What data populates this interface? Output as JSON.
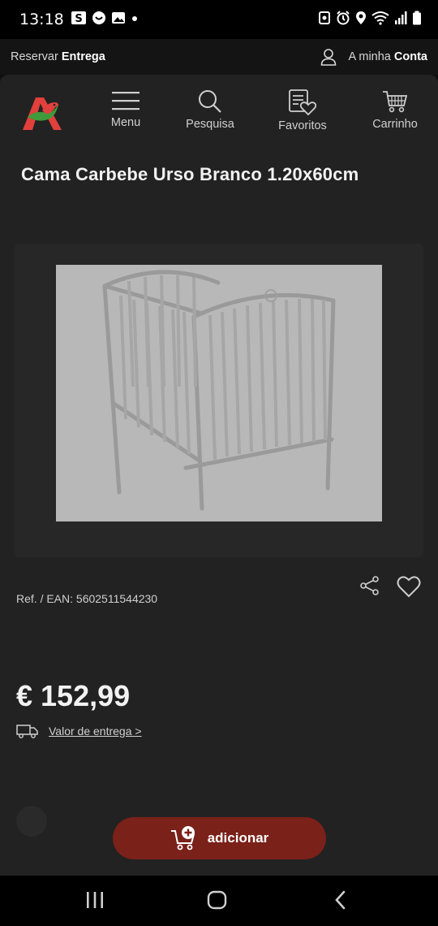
{
  "status_bar": {
    "time": "13:18",
    "icons_left": [
      "s-icon",
      "notification-icon",
      "gallery-icon",
      "dot-icon"
    ],
    "icons_right": [
      "nfc-icon",
      "alarm-icon",
      "location-icon",
      "wifi-icon",
      "signal-icon",
      "battery-icon"
    ]
  },
  "top_strip": {
    "reserve_prefix": "Reservar",
    "reserve_bold": "Entrega",
    "account_prefix": "A minha",
    "account_bold": "Conta"
  },
  "nav": {
    "items": [
      {
        "label": "Menu",
        "icon": "hamburger-icon"
      },
      {
        "label": "Pesquisa",
        "icon": "search-icon"
      },
      {
        "label": "Favoritos",
        "icon": "favorites-list-icon"
      },
      {
        "label": "Carrinho",
        "icon": "cart-icon"
      }
    ],
    "logo_colors": {
      "red": "#e1403c",
      "green": "#3e9a3a"
    }
  },
  "product": {
    "title": "Cama Carbebe Urso Branco 1.20x60cm",
    "ref": "Ref. / EAN: 5602511544230",
    "price": "€ 152,99",
    "delivery_link": "Valor de entrega >"
  },
  "cta": {
    "label": "adicionar",
    "color": "#7a2119"
  }
}
